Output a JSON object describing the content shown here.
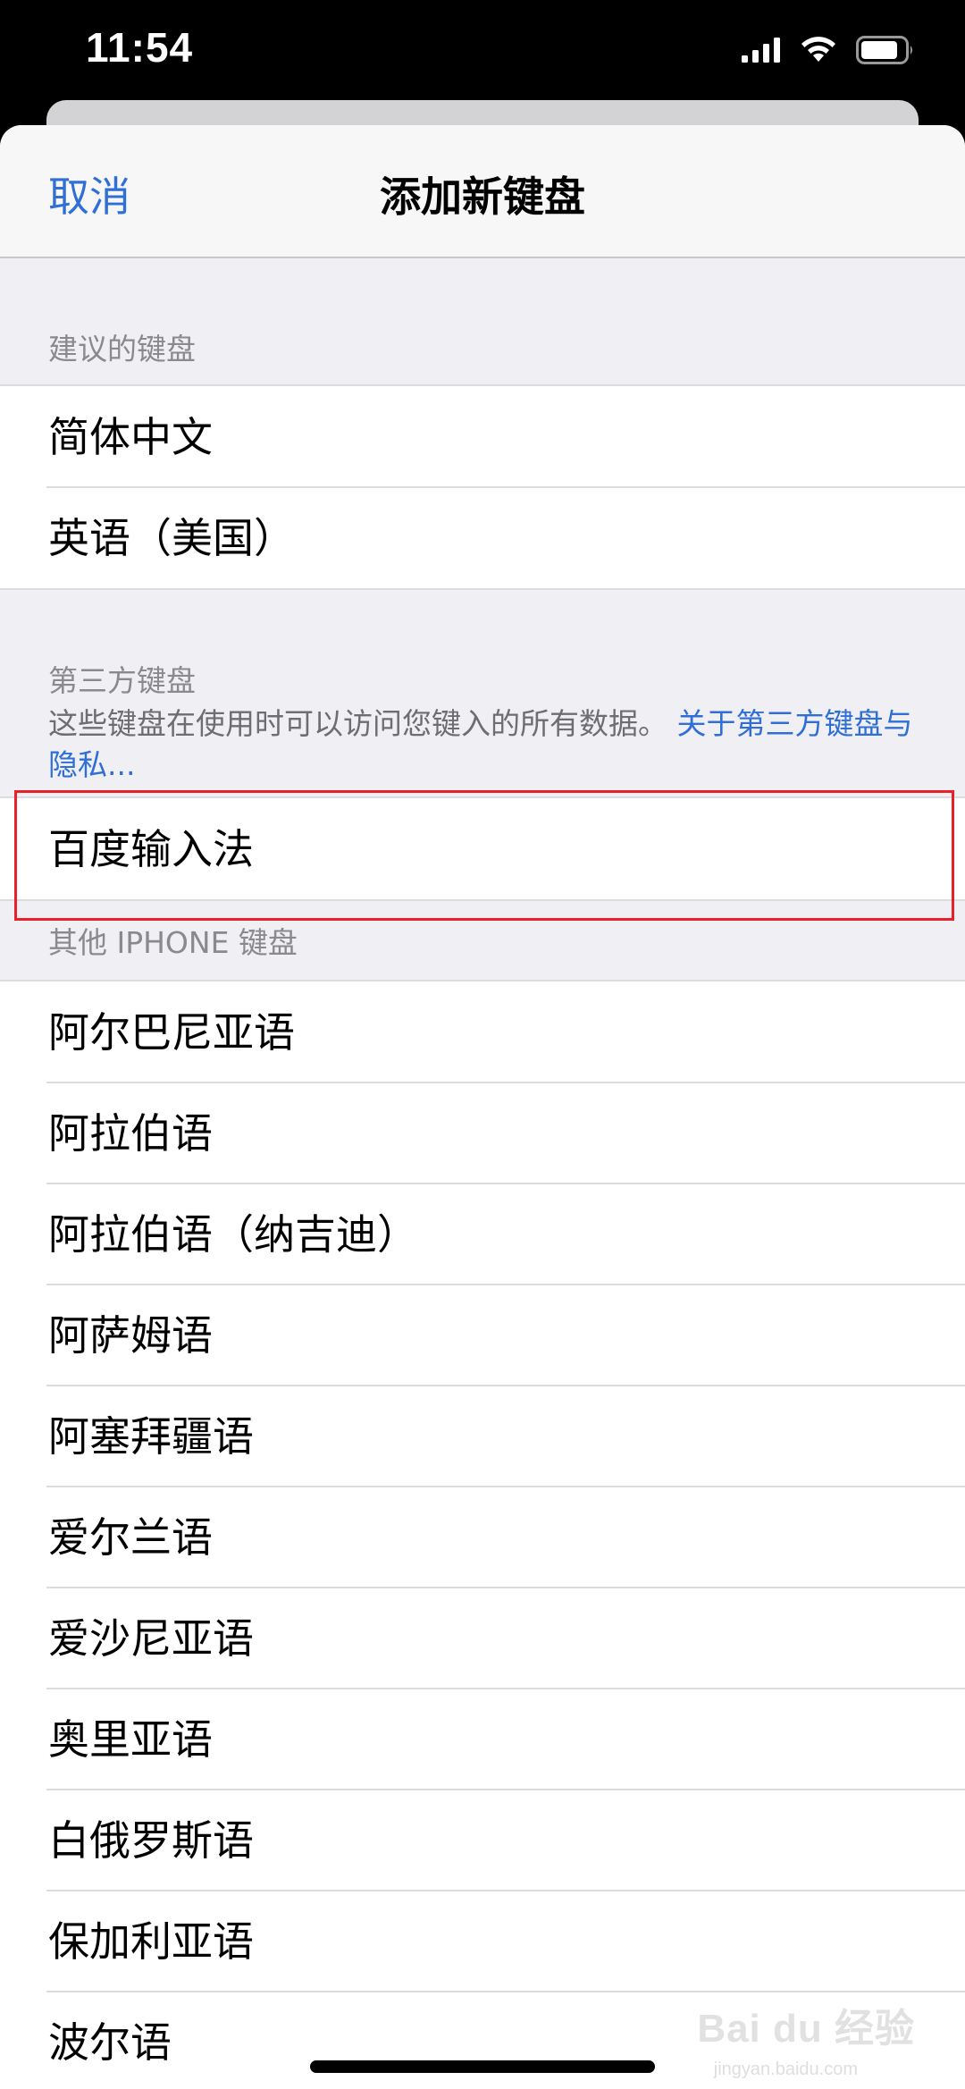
{
  "status_bar": {
    "time": "11:54",
    "icons": [
      "signal-icon",
      "wifi-icon",
      "battery-icon"
    ]
  },
  "nav": {
    "cancel_label": "取消",
    "title": "添加新键盘"
  },
  "sections": {
    "suggested": {
      "header": "建议的键盘",
      "items": [
        "简体中文",
        "英语（美国）"
      ]
    },
    "third_party": {
      "header": "第三方键盘",
      "description": "这些键盘在使用时可以访问您键入的所有数据。",
      "link_text": "关于第三方键盘与隐私...",
      "items": [
        "百度输入法"
      ]
    },
    "other": {
      "header": "其他 IPHONE 键盘",
      "items": [
        "阿尔巴尼亚语",
        "阿拉伯语",
        "阿拉伯语（纳吉迪）",
        "阿萨姆语",
        "阿塞拜疆语",
        "爱尔兰语",
        "爱沙尼亚语",
        "奥里亚语",
        "白俄罗斯语",
        "保加利亚语",
        "波尔语"
      ]
    }
  },
  "watermark": {
    "main": "Bai du 经验",
    "sub": "jingyan.baidu.com"
  },
  "colors": {
    "accent": "#2f6fd6",
    "highlight": "#e8202a",
    "background": "#efeff4"
  }
}
